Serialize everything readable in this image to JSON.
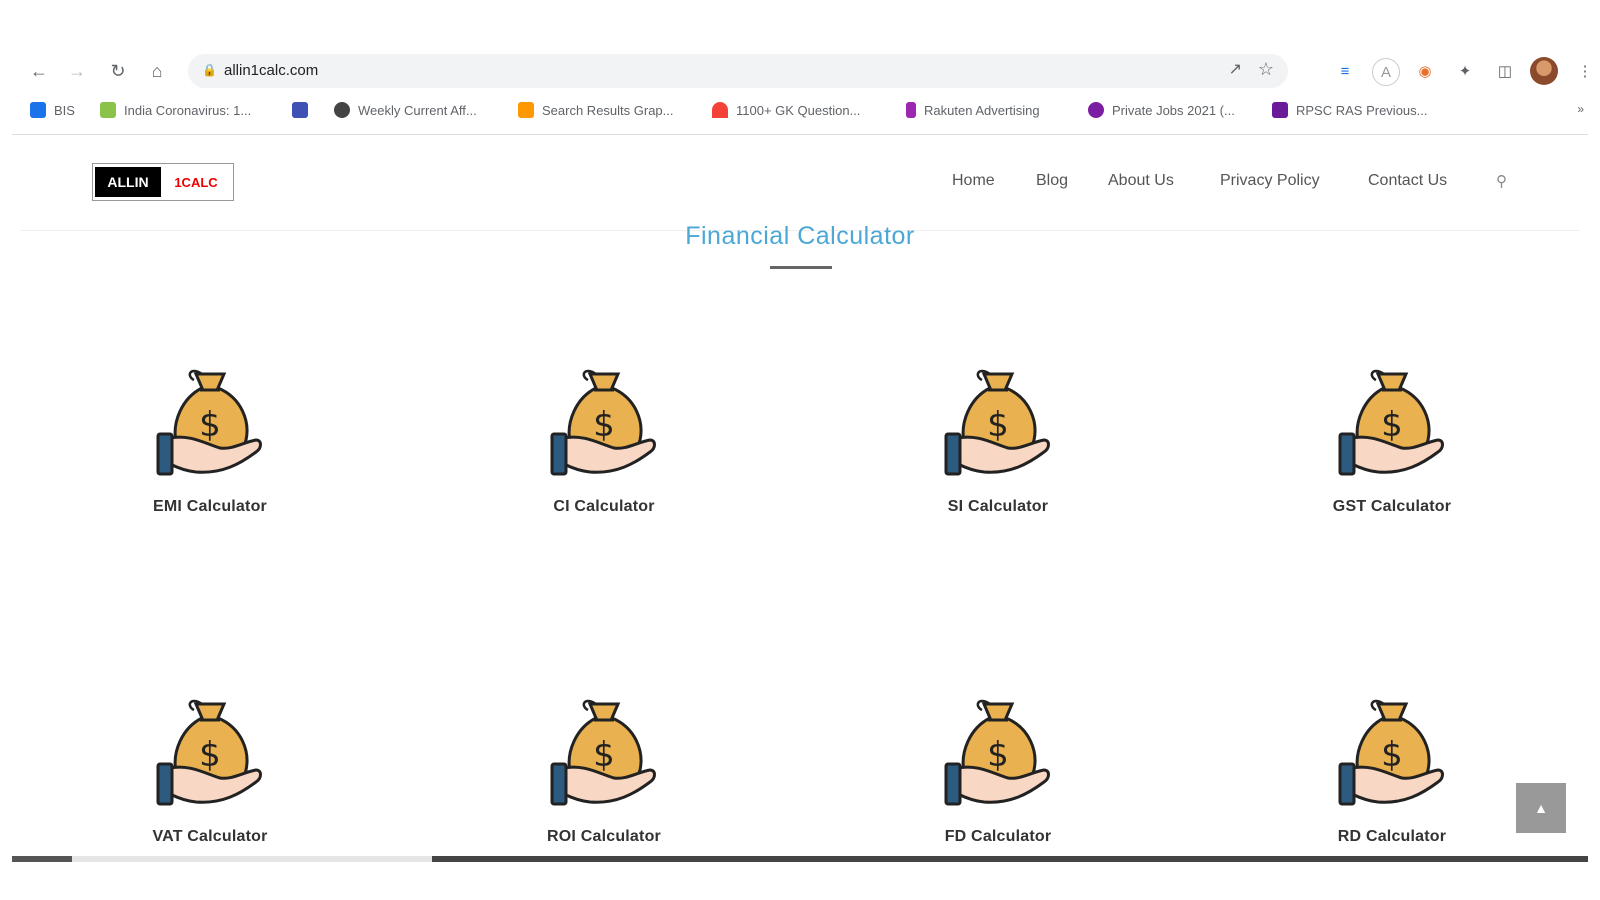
{
  "browser": {
    "url": "allin1calc.com",
    "bookmarks": [
      {
        "label": "BIS",
        "color": "#1a73e8"
      },
      {
        "label": "India Coronavirus: 1...",
        "color": "#8bc34a"
      },
      {
        "label": "",
        "color": "#3f51b5"
      },
      {
        "label": "Weekly Current Aff...",
        "color": "#444444"
      },
      {
        "label": "Search Results Grap...",
        "color": "#ff9800"
      },
      {
        "label": "1100+ GK Question...",
        "color": "#f44336"
      },
      {
        "label": "Rakuten Advertising",
        "color": "#9c27b0"
      },
      {
        "label": "Private Jobs 2021 (...",
        "color": "#7b1fa2"
      },
      {
        "label": "RPSC RAS Previous...",
        "color": "#6a1b9a"
      }
    ],
    "bookmarks_more": "»"
  },
  "site": {
    "logo": {
      "part1": "ALLIN",
      "part2": "1CALC"
    },
    "nav": [
      "Home",
      "Blog",
      "About Us",
      "Privacy Policy",
      "Contact Us"
    ]
  },
  "section": {
    "title": "Financial Calculator"
  },
  "calculators": [
    {
      "label": "EMI Calculator"
    },
    {
      "label": "CI Calculator"
    },
    {
      "label": "SI Calculator"
    },
    {
      "label": "GST Calculator"
    },
    {
      "label": "VAT Calculator"
    },
    {
      "label": "ROI Calculator"
    },
    {
      "label": "FD Calculator"
    },
    {
      "label": "RD Calculator"
    }
  ],
  "colors": {
    "accent": "#4aa7d6",
    "bag": "#e9b14f",
    "bag_outline": "#222222",
    "hand": "#f8d7c4",
    "cuff": "#2d5b7f"
  }
}
